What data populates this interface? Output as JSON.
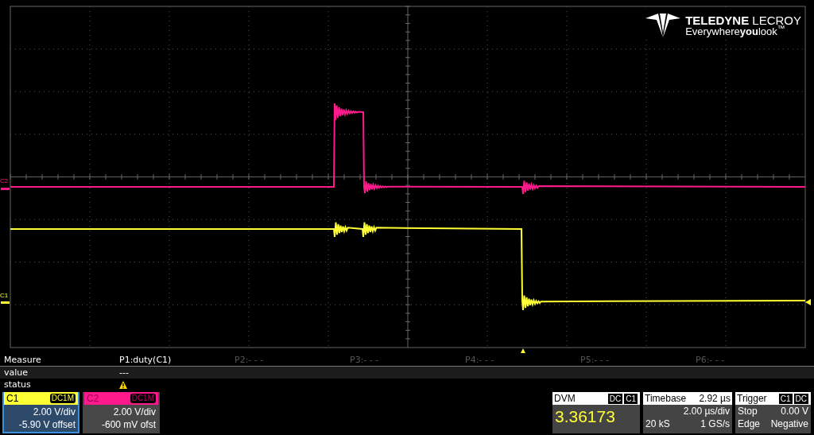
{
  "logo": {
    "brand": "**TELEDYNE** LECROY",
    "tagline": "Everywhere**you**look$^{™}$"
  },
  "trace_labels": [
    {
      "label": "C2",
      "color": "#ff1a8c"
    },
    {
      "label": "C1",
      "color": "#ffff33"
    }
  ],
  "measure": {
    "title": "Measure",
    "columns": [
      {
        "label": "P1:duty(C1)",
        "active": true
      },
      {
        "label": "P2:- - -",
        "active": false
      },
      {
        "label": "P3:- - -",
        "active": false
      },
      {
        "label": "P4:- - -",
        "active": false
      },
      {
        "label": "P5:- - -",
        "active": false
      },
      {
        "label": "P6:- - -",
        "active": false
      }
    ],
    "value_row": {
      "label": "value",
      "values": [
        "---"
      ]
    },
    "status_row": {
      "label": "status",
      "warnings": [
        true
      ]
    }
  },
  "channels": [
    {
      "name": "C1",
      "coupling": "DC1M",
      "scale": "2.00 V/div",
      "offset": "-5.90 V offset",
      "color": "#ffff33",
      "selected": true
    },
    {
      "name": "C2",
      "coupling": "DC1M",
      "scale": "2.00 V/div",
      "offset": "-600 mV ofst",
      "color": "#ff1a8c",
      "selected": false
    }
  ],
  "dvm": {
    "title": "DVM",
    "tags": [
      "DC",
      "C1"
    ],
    "reading": "3.36173"
  },
  "timebase": {
    "title": "Timebase",
    "delay": "2.92 µs",
    "scale": "2.00 µs/div",
    "samples": "20 kS",
    "rate": "1 GS/s"
  },
  "trigger": {
    "title": "Trigger",
    "tags": [
      "C1",
      "DC"
    ],
    "mode": "Stop",
    "threshold": "0.00 V",
    "type": "Edge",
    "slope": "Negative"
  }
}
